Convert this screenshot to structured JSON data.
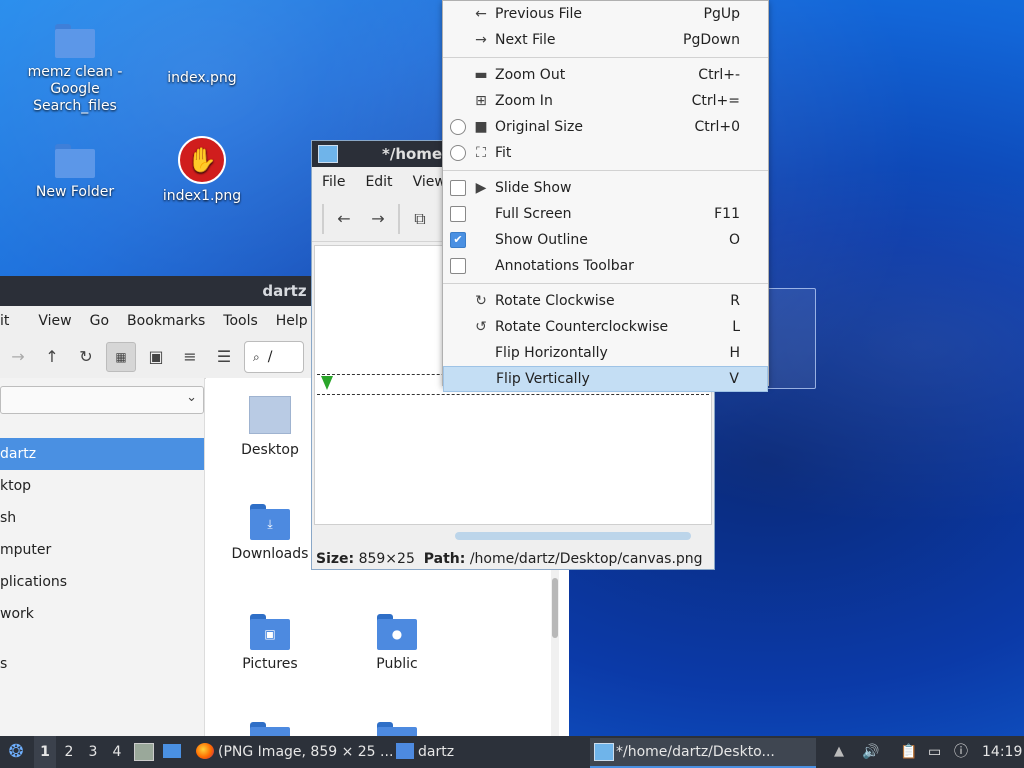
{
  "desktop": {
    "icons": [
      {
        "label": "memz clean - Google Search_files"
      },
      {
        "label": "index.png"
      },
      {
        "label": "New Folder"
      },
      {
        "label": "index1.png"
      }
    ]
  },
  "file_manager": {
    "title": "dartz",
    "menu": [
      "it",
      "View",
      "Go",
      "Bookmarks",
      "Tools",
      "Help"
    ],
    "location": "/",
    "sidebar": [
      "dartz",
      "ktop",
      "sh",
      "mputer",
      "plications",
      "work",
      "s"
    ],
    "items": [
      "Desktop",
      "Downloads",
      "Pictures",
      "Public"
    ]
  },
  "image_viewer": {
    "title": "*/home",
    "menu": [
      "File",
      "Edit",
      "View"
    ],
    "status": {
      "size_label": "Size:",
      "size": "859×25",
      "path_label": "Path:",
      "path": "/home/dartz/Desktop/canvas.png"
    }
  },
  "context_menu": {
    "items": [
      {
        "label": "Previous File",
        "shortcut": "PgUp",
        "icon": "arrow-left-icon"
      },
      {
        "label": "Next File",
        "shortcut": "PgDown",
        "icon": "arrow-right-icon"
      },
      {
        "label": "Zoom Out",
        "shortcut": "Ctrl+-",
        "icon": "zoom-out-icon"
      },
      {
        "label": "Zoom In",
        "shortcut": "Ctrl+=",
        "icon": "zoom-in-icon"
      },
      {
        "label": "Original Size",
        "shortcut": "Ctrl+0",
        "icon": "original-size-icon"
      },
      {
        "label": "Fit",
        "shortcut": "",
        "icon": "fit-icon"
      },
      {
        "label": "Slide Show",
        "shortcut": "",
        "icon": "play-icon"
      },
      {
        "label": "Full Screen",
        "shortcut": "F11"
      },
      {
        "label": "Show Outline",
        "shortcut": "O",
        "checked": true
      },
      {
        "label": "Annotations Toolbar",
        "shortcut": ""
      },
      {
        "label": "Rotate Clockwise",
        "shortcut": "R",
        "icon": "rotate-cw-icon"
      },
      {
        "label": "Rotate Counterclockwise",
        "shortcut": "L",
        "icon": "rotate-ccw-icon"
      },
      {
        "label": "Flip Horizontally",
        "shortcut": "H"
      },
      {
        "label": "Flip Vertically",
        "shortcut": "V",
        "highlighted": true
      }
    ]
  },
  "taskbar": {
    "workspaces": [
      "1",
      "2",
      "3",
      "4"
    ],
    "tasks": [
      "(PNG Image, 859 × 25 ...",
      "dartz",
      "*/home/dartz/Deskto..."
    ],
    "clock": "14:19"
  }
}
